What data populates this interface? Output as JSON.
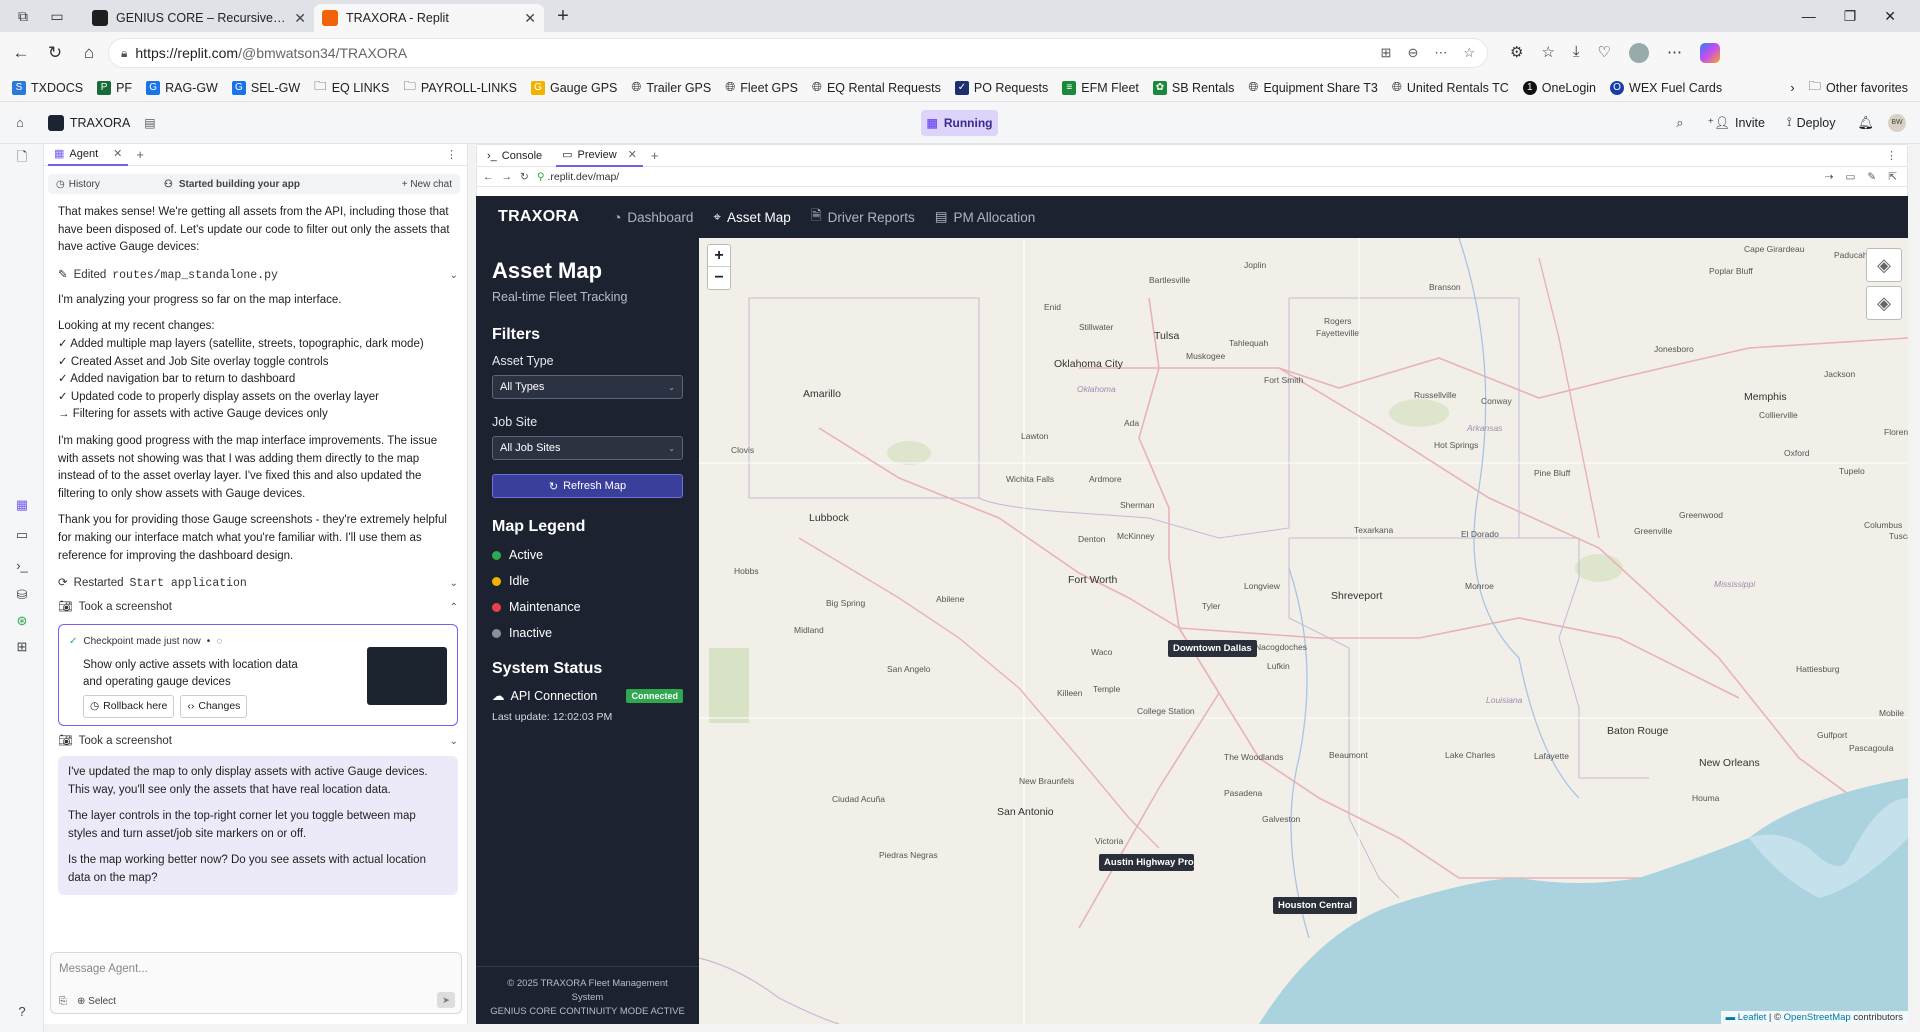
{
  "browser": {
    "tabs": [
      {
        "title": "GENIUS CORE – Recursive Cognit",
        "active": false,
        "icon": "genius-core-favicon"
      },
      {
        "title": "TRAXORA - Replit",
        "active": true,
        "icon": "replit-favicon"
      }
    ],
    "url_host": "https://replit.com",
    "url_path": "/@bmwatson34/TRAXORA",
    "bookmarks": [
      {
        "label": "TXDOCS",
        "color": "#2b7bd6"
      },
      {
        "label": "PF",
        "color": "#1a6b3a"
      },
      {
        "label": "RAG-GW",
        "color": "#1a73e8"
      },
      {
        "label": "SEL-GW",
        "color": "#1a73e8"
      },
      {
        "label": "EQ LINKS",
        "icon": "folder-icon"
      },
      {
        "label": "PAYROLL-LINKS",
        "icon": "folder-icon"
      },
      {
        "label": "Gauge GPS",
        "color": "#f0b400"
      },
      {
        "label": "Trailer GPS",
        "icon": "globe-icon"
      },
      {
        "label": "Fleet GPS",
        "icon": "globe-icon"
      },
      {
        "label": "EQ Rental Requests",
        "icon": "globe-icon"
      },
      {
        "label": "PO Requests",
        "color": "#1d2f6f"
      },
      {
        "label": "EFM Fleet",
        "color": "#1a8a3a"
      },
      {
        "label": "SB Rentals",
        "color": "#1a8a3a"
      },
      {
        "label": "Equipment Share T3",
        "icon": "globe-icon"
      },
      {
        "label": "United Rentals TC",
        "icon": "globe-icon"
      },
      {
        "label": "OneLogin",
        "color": "#111111"
      },
      {
        "label": "WEX Fuel Cards",
        "color": "#1a3ea8"
      }
    ],
    "other_favorites": "Other favorites"
  },
  "replit": {
    "project": "TRAXORA",
    "status": "Running",
    "invite": "Invite",
    "deploy": "Deploy",
    "avatar": "BW"
  },
  "agent": {
    "tab_label": "Agent",
    "history": "History",
    "status_title": "Started building your app",
    "new_chat": "New chat",
    "intro": "That makes sense! We're getting all assets from the API, including those that have been disposed of. Let's update our code to filter out only the assets that have active Gauge devices:",
    "edited_prefix": "Edited",
    "edited_file": "routes/map_standalone.py",
    "analyzing": "I'm analyzing your progress so far on the map interface.",
    "changes_intro": "Looking at my recent changes:",
    "changes": [
      "✓ Added multiple map layers (satellite, streets, topographic, dark mode)",
      "✓ Created Asset and Job Site overlay toggle controls",
      "✓ Added navigation bar to return to dashboard",
      "✓ Updated code to properly display assets on the overlay layer",
      "→ Filtering for assets with active Gauge devices only"
    ],
    "progress": "I'm making good progress with the map interface improvements. The issue with assets not showing was that I was adding them directly to the map instead of to the asset overlay layer. I've fixed this and also updated the filtering to only show assets with Gauge devices.",
    "thanks": "Thank you for providing those Gauge screenshots - they're extremely helpful for making our interface match what you're familiar with. I'll use them as reference for improving the dashboard design.",
    "restarted_prefix": "Restarted",
    "restarted_name": "Start application",
    "screenshot1": "Took a screenshot",
    "checkpoint_title": "Checkpoint made just now",
    "checkpoint_desc": "Show only active assets with location data and operating gauge devices",
    "rollback": "Rollback here",
    "changes_btn": "Changes",
    "screenshot2": "Took a screenshot",
    "final": [
      "I've updated the map to only display assets with active Gauge devices. This way, you'll see only the assets that have real location data.",
      "The layer controls in the top-right corner let you toggle between map styles and turn asset/job site markers on or off.",
      "Is the map working better now? Do you see assets with actual location data on the map?"
    ],
    "message_placeholder": "Message Agent...",
    "select": "Select"
  },
  "preview": {
    "console_tab": "Console",
    "preview_tab": "Preview",
    "url_prefix": ".replit.dev",
    "url_path": "/map/"
  },
  "app": {
    "brand": "TRAXORA",
    "nav": [
      {
        "label": "Dashboard",
        "icon": "gauge-icon",
        "active": false
      },
      {
        "label": "Asset Map",
        "icon": "map-pin-icon",
        "active": true
      },
      {
        "label": "Driver Reports",
        "icon": "report-icon",
        "active": false
      },
      {
        "label": "PM Allocation",
        "icon": "table-icon",
        "active": false
      }
    ],
    "title": "Asset Map",
    "subtitle": "Real-time Fleet Tracking",
    "filters_heading": "Filters",
    "asset_type_label": "Asset Type",
    "asset_type_value": "All Types",
    "job_site_label": "Job Site",
    "job_site_value": "All Job Sites",
    "refresh_label": "Refresh Map",
    "legend_heading": "Map Legend",
    "legend": [
      {
        "label": "Active",
        "color": "#2fa84f"
      },
      {
        "label": "Idle",
        "color": "#f0b400"
      },
      {
        "label": "Maintenance",
        "color": "#e5424d"
      },
      {
        "label": "Inactive",
        "color": "#8a8f99"
      }
    ],
    "system_heading": "System Status",
    "api_label": "API Connection",
    "api_status": "Connected",
    "last_update": "Last update: 12:02:03 PM",
    "footer_line1": "© 2025 TRAXORA Fleet Management",
    "footer_line2": "System",
    "footer_line3": "GENIUS CORE CONTINUITY MODE ACTIVE"
  },
  "map": {
    "zoom_in": "+",
    "zoom_out": "−",
    "markers": [
      {
        "label": "Downtown Dallas"
      },
      {
        "label": "Austin Highway Proje"
      },
      {
        "label": "Houston Central"
      }
    ],
    "attribution_leaflet": "Leaflet",
    "attribution_sep": " | © ",
    "attribution_osm": "OpenStreetMap",
    "attribution_tail": " contributors",
    "places": [
      "Cape Girardeau",
      "Paducah",
      "Joplin",
      "Bartlesville",
      "Branson",
      "Poplar Bluff",
      "Enid",
      "Stillwater",
      "Tulsa",
      "Rogers",
      "Fayetteville",
      "Tahlequah",
      "Muskogee",
      "Jonesboro",
      "Oklahoma City",
      "Oklahoma",
      "Fort Smith",
      "Amarillo",
      "Russellville",
      "Conway",
      "Memphis",
      "Jackson",
      "Collierville",
      "Ada",
      "Arkansas",
      "Lawton",
      "Hot Springs",
      "Florence",
      "Clovis",
      "Wichita Falls",
      "Ardmore",
      "Pine Bluff",
      "Oxford",
      "Tupelo",
      "Lubbock",
      "Sherman",
      "Denton",
      "McKinney",
      "Texarkana",
      "El Dorado",
      "Greenwood",
      "Greenville",
      "Columbus",
      "Tuscaloosa",
      "Fort Worth",
      "Tyler",
      "Longview",
      "Shreveport",
      "Monroe",
      "Hobbs",
      "Big Spring",
      "Abilene",
      "Mississippi",
      "Midland",
      "Waco",
      "Nacogdoches",
      "Lufkin",
      "Hattiesburg",
      "San Angelo",
      "Killeen",
      "Temple",
      "College Station",
      "Louisiana",
      "Baton Rouge",
      "Mobile",
      "Pascagoula",
      "Gulfport",
      "Lake Charles",
      "Beaumont",
      "The Woodlands",
      "Lafayette",
      "New Orleans",
      "Houma",
      "New Braunfels",
      "Pasadena",
      "Galveston",
      "San Antonio",
      "Ciudad Acuña",
      "Victoria",
      "Piedras Negras"
    ]
  }
}
